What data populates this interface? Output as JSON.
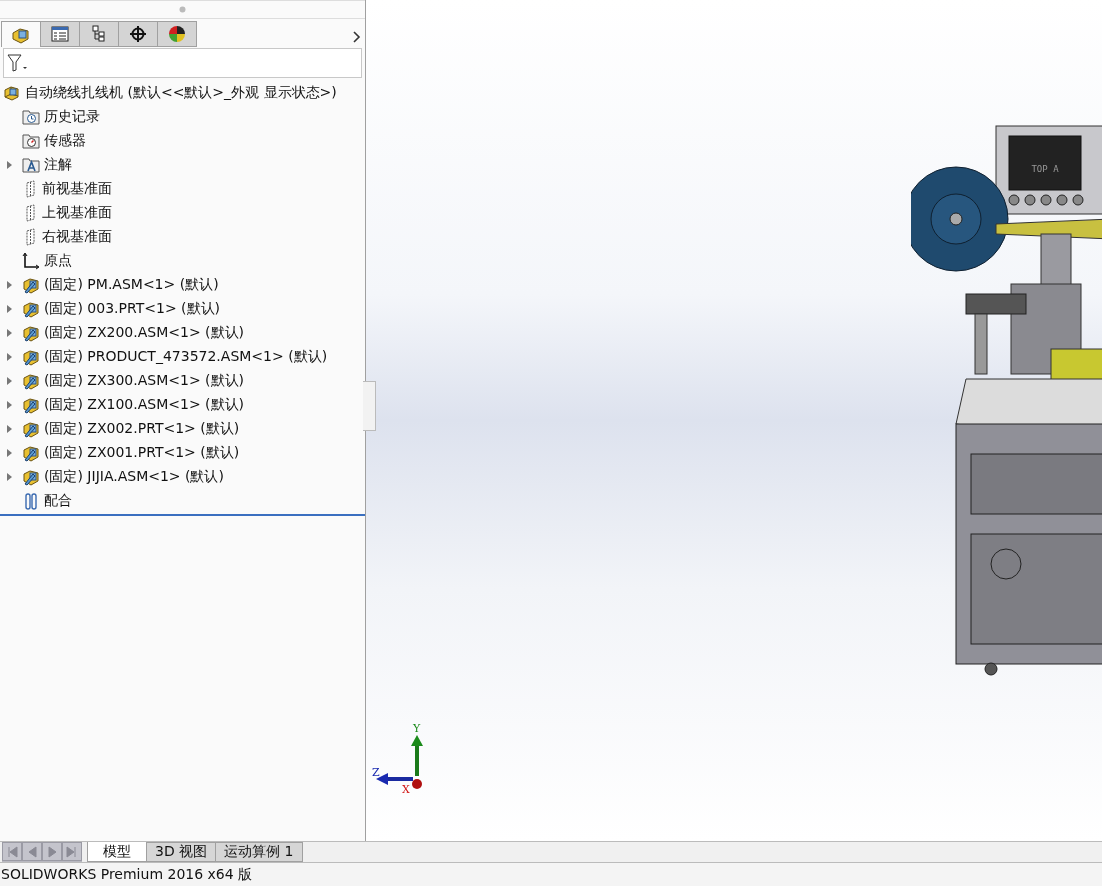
{
  "panel_tabs": [
    {
      "kind": "feature-tree",
      "selected": true
    },
    {
      "kind": "property",
      "selected": false
    },
    {
      "kind": "configuration",
      "selected": false
    },
    {
      "kind": "dimxpert",
      "selected": false
    },
    {
      "kind": "display",
      "selected": false
    }
  ],
  "tree": {
    "root": {
      "label": "自动绕线扎线机  (默认<<默认>_外观 显示状态>)"
    },
    "items": [
      {
        "kind": "history",
        "label": "历史记录",
        "expandable": false
      },
      {
        "kind": "sensor",
        "label": "传感器",
        "expandable": false
      },
      {
        "kind": "annotation",
        "label": "注解",
        "expandable": true
      },
      {
        "kind": "plane",
        "label": "前视基准面",
        "expandable": false
      },
      {
        "kind": "plane",
        "label": "上视基准面",
        "expandable": false
      },
      {
        "kind": "plane",
        "label": "右视基准面",
        "expandable": false
      },
      {
        "kind": "origin",
        "label": "原点",
        "expandable": false
      },
      {
        "kind": "component",
        "label": "(固定) PM.ASM<1> (默认)",
        "expandable": true
      },
      {
        "kind": "component",
        "label": "(固定) 003.PRT<1> (默认)",
        "expandable": true
      },
      {
        "kind": "component",
        "label": "(固定) ZX200.ASM<1> (默认)",
        "expandable": true
      },
      {
        "kind": "component",
        "label": "(固定) PRODUCT_473572.ASM<1> (默认)",
        "expandable": true
      },
      {
        "kind": "component",
        "label": "(固定) ZX300.ASM<1> (默认)",
        "expandable": true
      },
      {
        "kind": "component",
        "label": "(固定) ZX100.ASM<1> (默认)",
        "expandable": true
      },
      {
        "kind": "component",
        "label": "(固定) ZX002.PRT<1> (默认)",
        "expandable": true
      },
      {
        "kind": "component",
        "label": "(固定) ZX001.PRT<1> (默认)",
        "expandable": true
      },
      {
        "kind": "component",
        "label": "(固定) JIJIA.ASM<1> (默认)",
        "expandable": true
      },
      {
        "kind": "mates",
        "label": "配合",
        "expandable": false
      }
    ]
  },
  "viewport": {
    "model_screen_text": "TOP A",
    "triad": {
      "x": "X",
      "y": "Y",
      "z": "Z"
    }
  },
  "bottom_tabs": [
    {
      "label": "模型",
      "selected": true
    },
    {
      "label": "3D 视图",
      "selected": false
    },
    {
      "label": "运动算例 1",
      "selected": false
    }
  ],
  "status_bar": {
    "text": "SOLIDWORKS Premium 2016 x64 版"
  }
}
